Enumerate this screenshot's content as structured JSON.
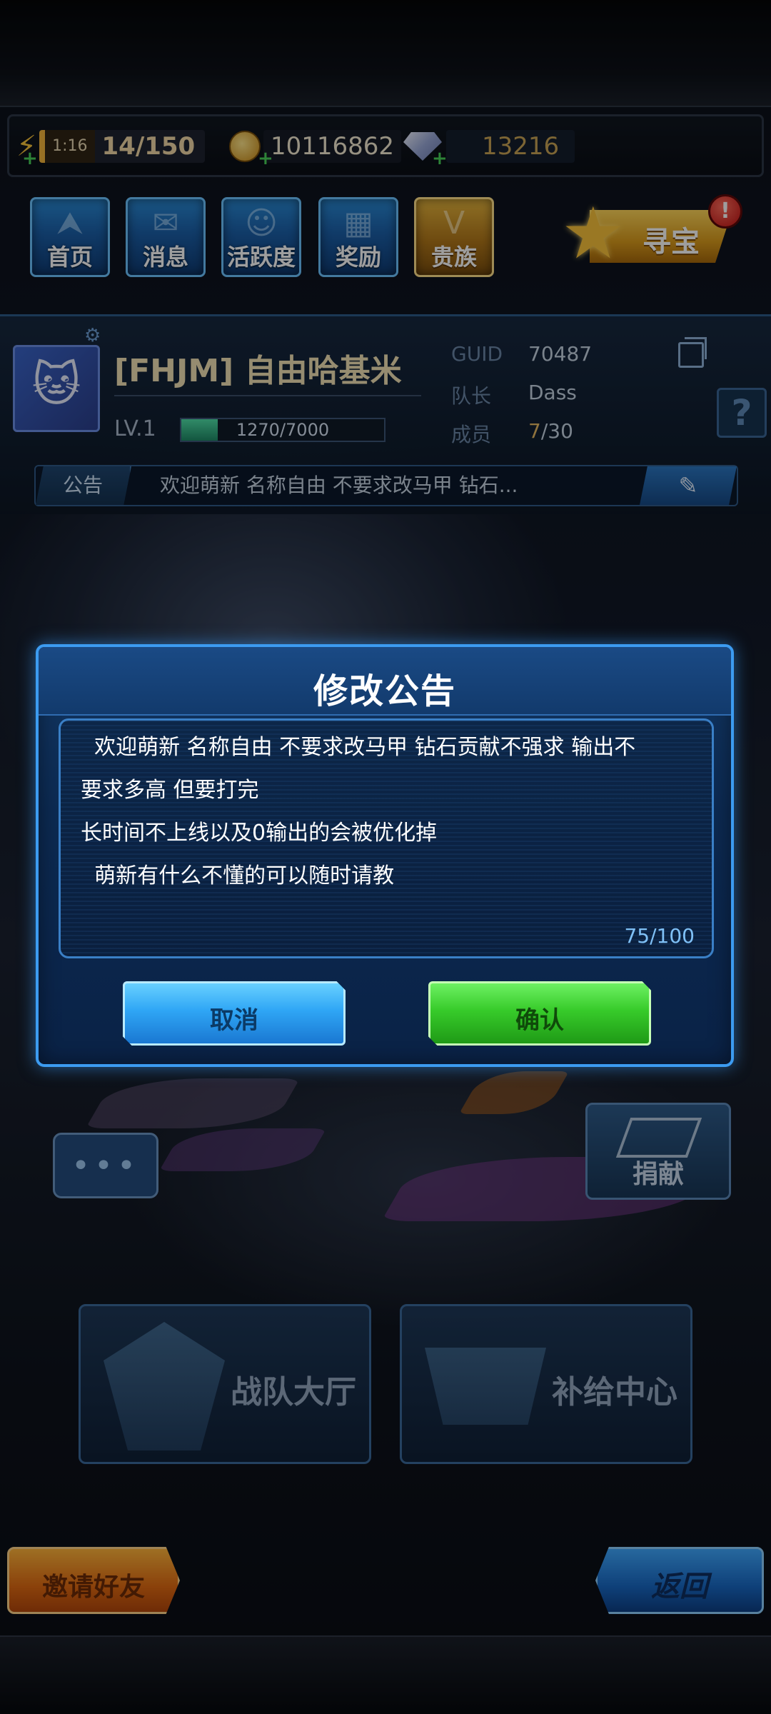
{
  "resources": {
    "energy_timer": "1:16",
    "energy": "14/150",
    "coins": "10116862",
    "gems": "13216"
  },
  "top_menu": {
    "items": [
      {
        "label": "首页",
        "icon": "home-icon"
      },
      {
        "label": "消息",
        "icon": "mail-icon"
      },
      {
        "label": "活跃度",
        "icon": "smile-icon"
      },
      {
        "label": "奖励",
        "icon": "gift-icon"
      },
      {
        "label": "贵族",
        "icon": "noble-icon"
      }
    ],
    "treasure_label": "寻宝",
    "treasure_badge": "!"
  },
  "guild": {
    "name": "[FHJM] 自由哈基米",
    "level": "LV.1",
    "exp_text": "1270/7000",
    "exp_fraction": 0.181,
    "guid_key": "GUID",
    "guid_value": "70487",
    "leader_key": "队长",
    "leader_value": "Dass",
    "members_key": "成员",
    "members_current": "7",
    "members_total": "/30",
    "notice_tag": "公告",
    "notice_preview": "欢迎萌新 名称自由 不要求改马甲 钻石..."
  },
  "dialog": {
    "title": "修改公告",
    "lines": [
      "  欢迎萌新 名称自由 不要求改马甲 钻石贡献不强求 输出不",
      "要求多高 但要打完",
      "长时间不上线以及0输出的会被优化掉",
      "  萌新有什么不懂的可以随时请教"
    ],
    "char_count": "75/100",
    "cancel_label": "取消",
    "confirm_label": "确认"
  },
  "lower": {
    "chat_dots": "•••",
    "donate_label": "捐献",
    "hall_label": "战队大厅",
    "supply_label": "补给中心",
    "invite_label": "邀请好友",
    "back_label": "返回"
  },
  "colors": {
    "dialog_border": "#3c9bf0",
    "confirm_green": "#37cb2a",
    "cancel_blue": "#2fa6f5",
    "noble_gold": "#e6b53d"
  }
}
